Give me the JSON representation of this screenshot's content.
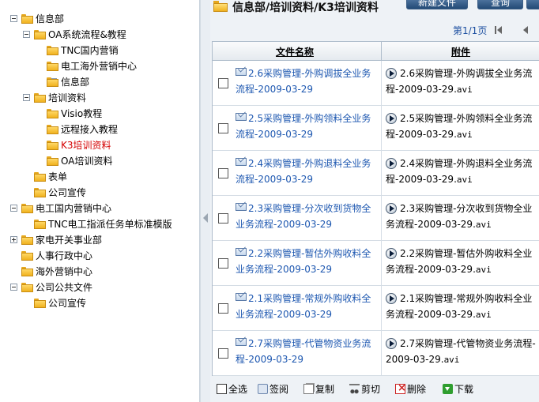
{
  "tree": [
    {
      "label": "信息部",
      "depth": 0,
      "toggle": "minus",
      "color": ""
    },
    {
      "label": "OA系统流程&教程",
      "depth": 1,
      "toggle": "minus",
      "color": ""
    },
    {
      "label": "TNC国内营销",
      "depth": 2,
      "toggle": "",
      "color": ""
    },
    {
      "label": "电工海外营销中心",
      "depth": 2,
      "toggle": "",
      "color": ""
    },
    {
      "label": "信息部",
      "depth": 2,
      "toggle": "plus",
      "color": ""
    },
    {
      "label": "培训资料",
      "depth": 1,
      "toggle": "minus",
      "color": ""
    },
    {
      "label": "Visio教程",
      "depth": 2,
      "toggle": "",
      "color": ""
    },
    {
      "label": "远程接入教程",
      "depth": 2,
      "toggle": "",
      "color": ""
    },
    {
      "label": "K3培训资料",
      "depth": 2,
      "toggle": "",
      "color": "#d40000"
    },
    {
      "label": "OA培训资料",
      "depth": 2,
      "toggle": "",
      "color": ""
    },
    {
      "label": "表单",
      "depth": 1,
      "toggle": "",
      "color": ""
    },
    {
      "label": "公司宣传",
      "depth": 1,
      "toggle": "",
      "color": ""
    },
    {
      "label": "电工国内营销中心",
      "depth": 0,
      "toggle": "minus",
      "color": ""
    },
    {
      "label": "TNC电工指派任务单标准模版",
      "depth": 1,
      "toggle": "",
      "color": ""
    },
    {
      "label": "家电开关事业部",
      "depth": 0,
      "toggle": "plus",
      "color": ""
    },
    {
      "label": "人事行政中心",
      "depth": 0,
      "toggle": "",
      "color": ""
    },
    {
      "label": "海外营销中心",
      "depth": 0,
      "toggle": "",
      "color": ""
    },
    {
      "label": "公司公共文件",
      "depth": 0,
      "toggle": "minus",
      "color": ""
    },
    {
      "label": "公司宣传",
      "depth": 1,
      "toggle": "",
      "color": ""
    }
  ],
  "header": {
    "title": "信息部/培训资料/K3培训资料",
    "buttons": [
      "新建文件",
      "查询"
    ],
    "pager": "第1/1页"
  },
  "table": {
    "columns": [
      "文件名称",
      "附件"
    ],
    "rows": [
      {
        "name": "2.6采购管理-外购调拔全业务流程-2009-03-29",
        "attach_text": "2.6采购管理-外购调拔全业务流程-2009-03-29.",
        "attach_ext": "avi"
      },
      {
        "name": "2.5采购管理-外购领料全业务流程-2009-03-29",
        "attach_text": "2.5采购管理-外购领料全业务流程-2009-03-29.",
        "attach_ext": "avi"
      },
      {
        "name": "2.4采购管理-外购退料全业务流程-2009-03-29",
        "attach_text": "2.4采购管理-外购退料全业务流程-2009-03-29.",
        "attach_ext": "avi"
      },
      {
        "name": "2.3采购管理-分次收到货物全业务流程-2009-03-29",
        "attach_text": "2.3采购管理-分次收到货物全业务流程-2009-03-29.",
        "attach_ext": "avi"
      },
      {
        "name": "2.2采购管理-暂估外购收料全业务流程-2009-03-29",
        "attach_text": "2.2采购管理-暂估外购收料全业务流程-2009-03-29.",
        "attach_ext": "avi"
      },
      {
        "name": "2.1采购管理-常规外购收料全业务流程-2009-03-29",
        "attach_text": "2.1采购管理-常规外购收料全业务流程-2009-03-29.",
        "attach_ext": "avi"
      },
      {
        "name": "2.7采购管理-代管物资业务流程-2009-03-29",
        "attach_text": "2.7采购管理-代管物资业务流程-2009-03-29.",
        "attach_ext": "avi"
      }
    ]
  },
  "footer": {
    "select_all": "全选",
    "read": "签阅",
    "copy": "复制",
    "cut": "剪切",
    "delete": "删除",
    "download": "下载"
  }
}
